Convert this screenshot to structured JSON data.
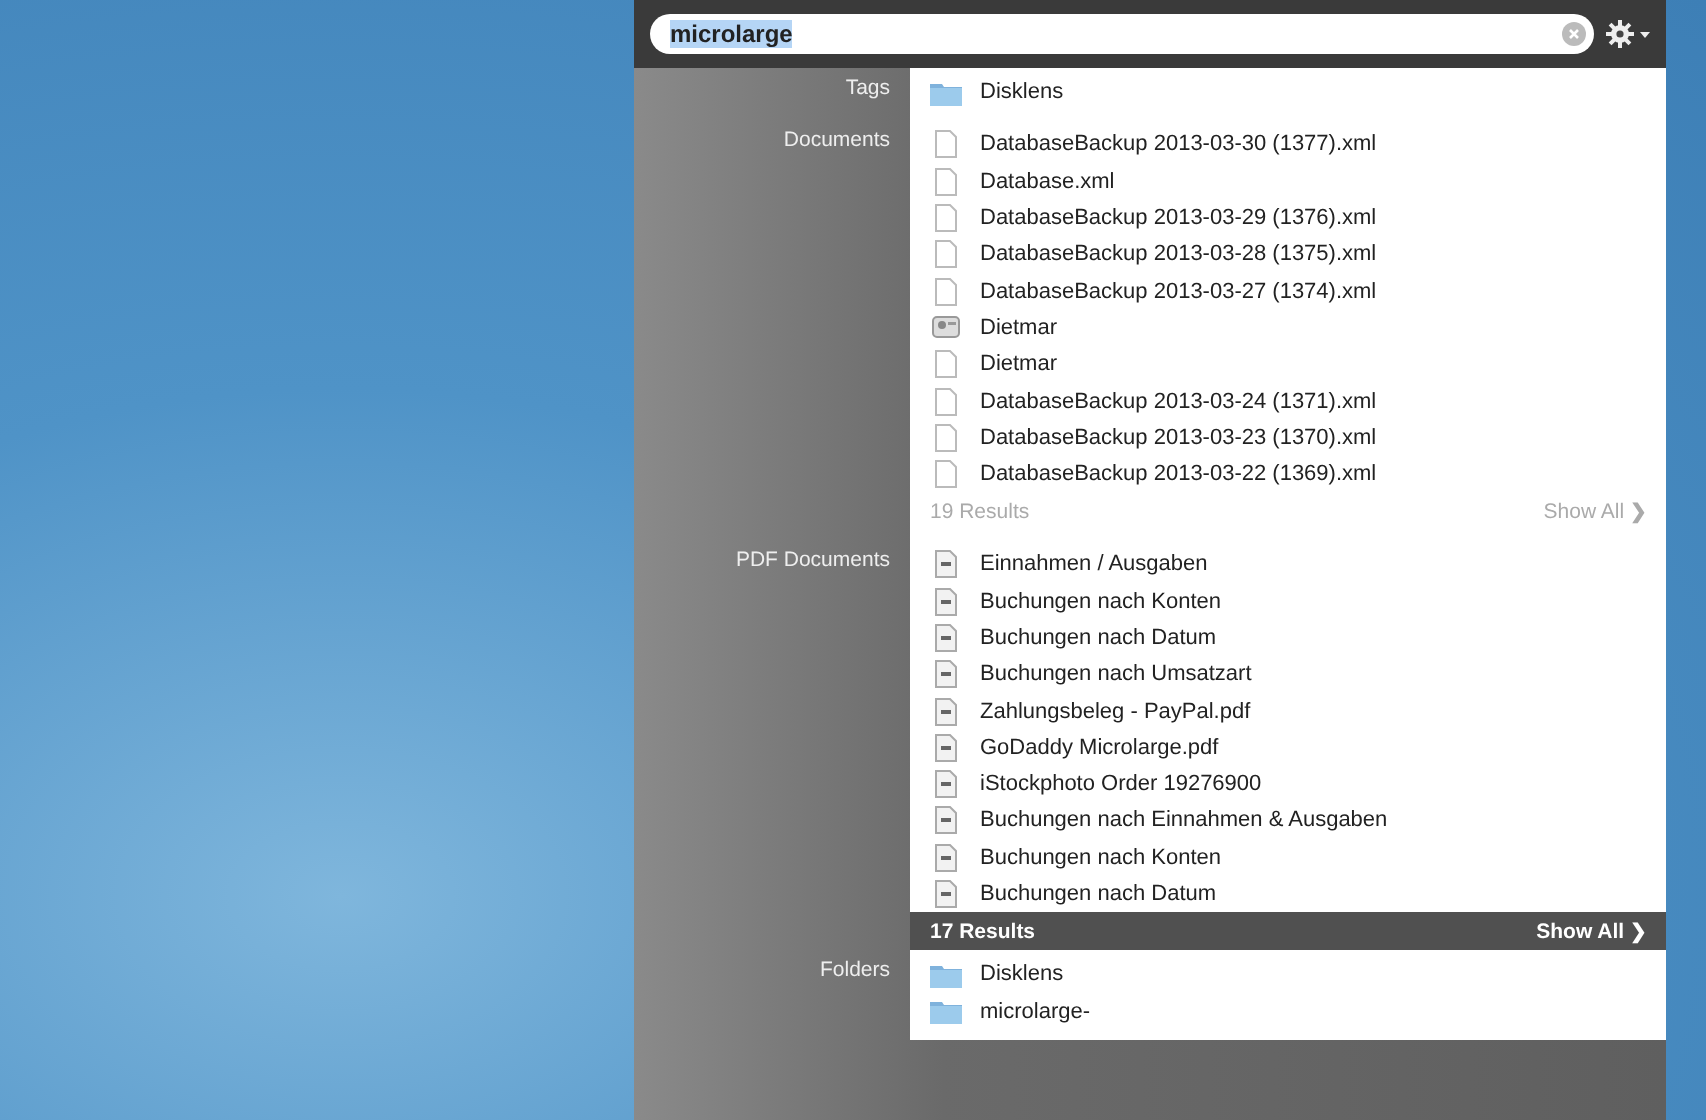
{
  "search": {
    "value": "microlarge"
  },
  "sections": [
    {
      "label": "Tags",
      "items": [
        {
          "kind": "folder",
          "name": "Disklens"
        }
      ]
    },
    {
      "label": "Documents",
      "items": [
        {
          "kind": "document",
          "name": "DatabaseBackup 2013-03-30 (1377).xml"
        },
        {
          "kind": "document",
          "name": "Database.xml"
        },
        {
          "kind": "document",
          "name": "DatabaseBackup 2013-03-29 (1376).xml"
        },
        {
          "kind": "document",
          "name": "DatabaseBackup 2013-03-28 (1375).xml"
        },
        {
          "kind": "document",
          "name": "DatabaseBackup 2013-03-27 (1374).xml"
        },
        {
          "kind": "contact",
          "name": "Dietmar"
        },
        {
          "kind": "document",
          "name": "Dietmar"
        },
        {
          "kind": "document",
          "name": "DatabaseBackup 2013-03-24 (1371).xml"
        },
        {
          "kind": "document",
          "name": "DatabaseBackup 2013-03-23 (1370).xml"
        },
        {
          "kind": "document",
          "name": "DatabaseBackup 2013-03-22 (1369).xml"
        }
      ],
      "footer": {
        "count": "19 Results",
        "show_all": "Show All",
        "arrow": "❯",
        "selected": false
      }
    },
    {
      "label": "PDF Documents",
      "items": [
        {
          "kind": "pdf",
          "name": "Einnahmen / Ausgaben"
        },
        {
          "kind": "pdf",
          "name": "Buchungen nach Konten"
        },
        {
          "kind": "pdf",
          "name": "Buchungen nach Datum"
        },
        {
          "kind": "pdf",
          "name": "Buchungen nach Umsatzart"
        },
        {
          "kind": "pdf",
          "name": "Zahlungsbeleg - PayPal.pdf"
        },
        {
          "kind": "pdf",
          "name": "GoDaddy Microlarge.pdf"
        },
        {
          "kind": "pdf",
          "name": "iStockphoto Order 19276900"
        },
        {
          "kind": "pdf",
          "name": "Buchungen nach Einnahmen & Ausgaben"
        },
        {
          "kind": "pdf",
          "name": "Buchungen nach Konten"
        },
        {
          "kind": "pdf",
          "name": "Buchungen nach Datum"
        }
      ],
      "footer": {
        "count": "17 Results",
        "show_all": "Show All",
        "arrow": "❯",
        "selected": true
      }
    },
    {
      "label": "Folders",
      "items": [
        {
          "kind": "folder",
          "name": "Disklens"
        },
        {
          "kind": "folder",
          "name": "microlarge-"
        }
      ]
    }
  ]
}
